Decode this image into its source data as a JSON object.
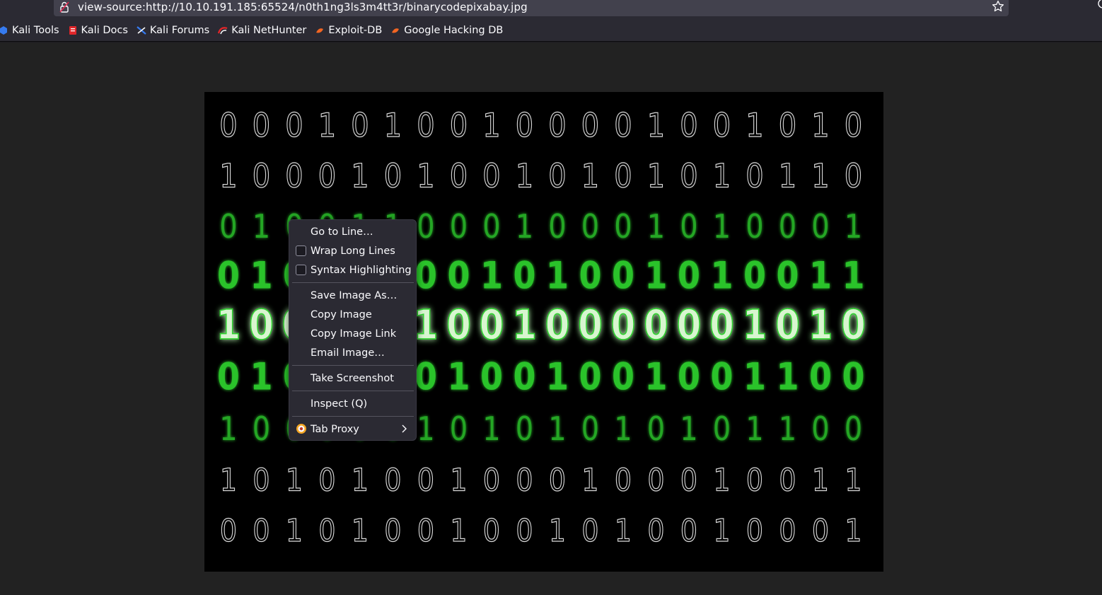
{
  "browser": {
    "url": "view-source:http://10.10.191.185:65524/n0th1ng3ls3m4tt3r/binarycodepixabay.jpg",
    "bookmarks": [
      {
        "label": "Kali Tools",
        "icon": "kali-tools-icon",
        "color": "#367bf0"
      },
      {
        "label": "Kali Docs",
        "icon": "kali-docs-icon",
        "color": "#e0262a"
      },
      {
        "label": "Kali Forums",
        "icon": "kali-forums-icon",
        "color": "#367bf0"
      },
      {
        "label": "Kali NetHunter",
        "icon": "kali-nethunter-icon",
        "color": "#e0262a"
      },
      {
        "label": "Exploit-DB",
        "icon": "exploit-db-icon",
        "color": "#f26522"
      },
      {
        "label": "Google Hacking DB",
        "icon": "google-hacking-db-icon",
        "color": "#f26522"
      }
    ]
  },
  "image": {
    "description_colors": {
      "background": "#000000",
      "dim": "#d8d8d8",
      "glow": "#2fd12f"
    },
    "digit_rows": [
      "00010100100001001010",
      "10001010010101010110",
      "01001100010001010001",
      "01001100101001010011",
      "10000010010000001010",
      "01000101001001001100",
      "10000010101010101100",
      "10101001000100010011",
      "00101001001010010001"
    ]
  },
  "context_menu": {
    "go_to_line": "Go to Line…",
    "wrap_long_lines": "Wrap Long Lines",
    "syntax_highlighting": "Syntax Highlighting",
    "save_image_as": "Save Image As…",
    "copy_image": "Copy Image",
    "copy_image_link": "Copy Image Link",
    "email_image": "Email Image…",
    "take_screenshot": "Take Screenshot",
    "inspect": "Inspect (Q)",
    "tab_proxy": "Tab Proxy",
    "wrap_long_lines_checked": false,
    "syntax_highlighting_checked": false
  }
}
